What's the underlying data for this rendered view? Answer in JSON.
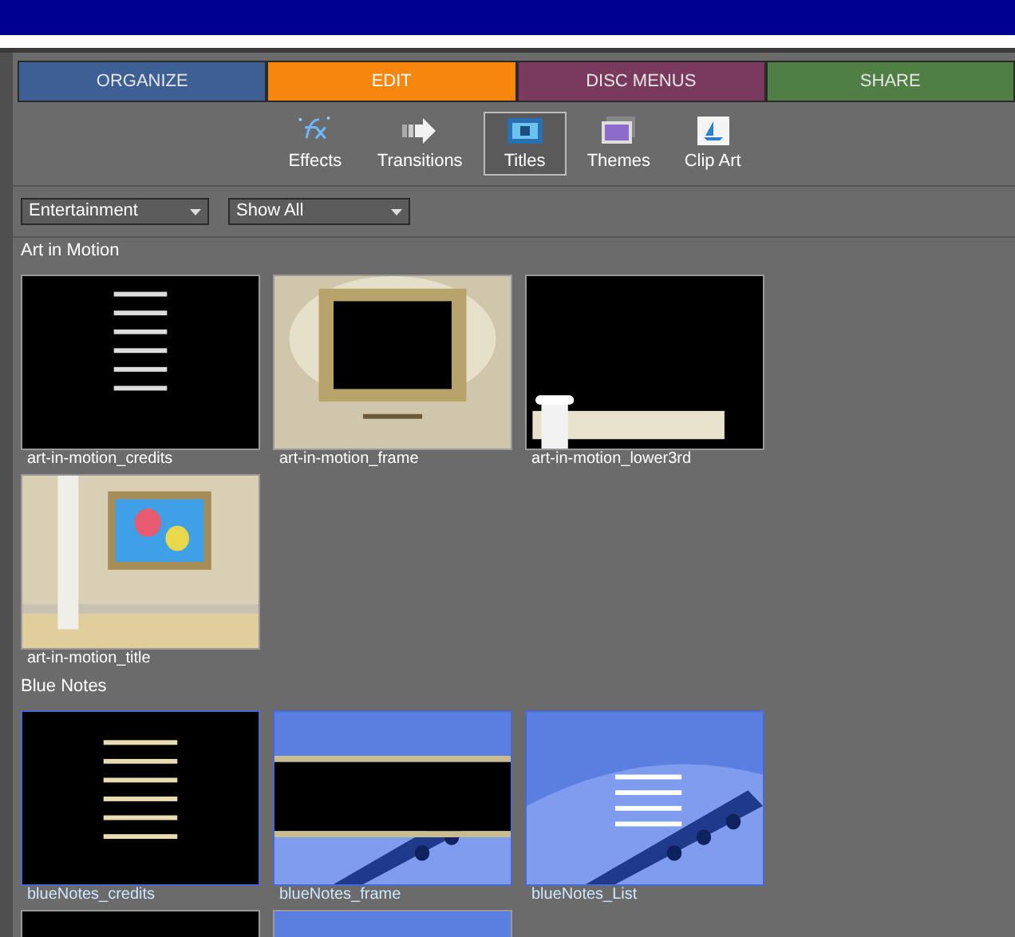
{
  "tabs": [
    {
      "label": "ORGANIZE",
      "selected": false,
      "color": "#3d5f94"
    },
    {
      "label": "EDIT",
      "selected": true,
      "color": "#f7860f"
    },
    {
      "label": "DISC MENUS",
      "selected": false,
      "color": "#7a3a5e"
    },
    {
      "label": "SHARE",
      "selected": false,
      "color": "#4f7f45"
    }
  ],
  "toolbar": [
    {
      "label": "Effects",
      "kind": "effects",
      "selected": false
    },
    {
      "label": "Transitions",
      "kind": "transitions",
      "selected": false
    },
    {
      "label": "Titles",
      "kind": "titles",
      "selected": true
    },
    {
      "label": "Themes",
      "kind": "themes",
      "selected": false
    },
    {
      "label": "Clip Art",
      "kind": "clipart",
      "selected": false
    }
  ],
  "filters": [
    {
      "value": "Entertainment"
    },
    {
      "value": "Show All"
    }
  ],
  "sections": [
    {
      "title": "Art in Motion",
      "items": [
        {
          "label": "art-in-motion_credits",
          "kind": "credits",
          "selected": false
        },
        {
          "label": "art-in-motion_frame",
          "kind": "frame",
          "selected": false
        },
        {
          "label": "art-in-motion_lower3rd",
          "kind": "lower3rd",
          "selected": false
        },
        {
          "label": "art-in-motion_title",
          "kind": "room",
          "selected": false
        }
      ]
    },
    {
      "title": "Blue Notes",
      "items": [
        {
          "label": "blueNotes_credits",
          "kind": "bluecredits",
          "selected": true
        },
        {
          "label": "blueNotes_frame",
          "kind": "blueframe",
          "selected": true
        },
        {
          "label": "blueNotes_List",
          "kind": "bluelist",
          "selected": true
        },
        {
          "kind": "black",
          "selected": false
        },
        {
          "kind": "blueframe",
          "selected": false
        }
      ]
    }
  ]
}
